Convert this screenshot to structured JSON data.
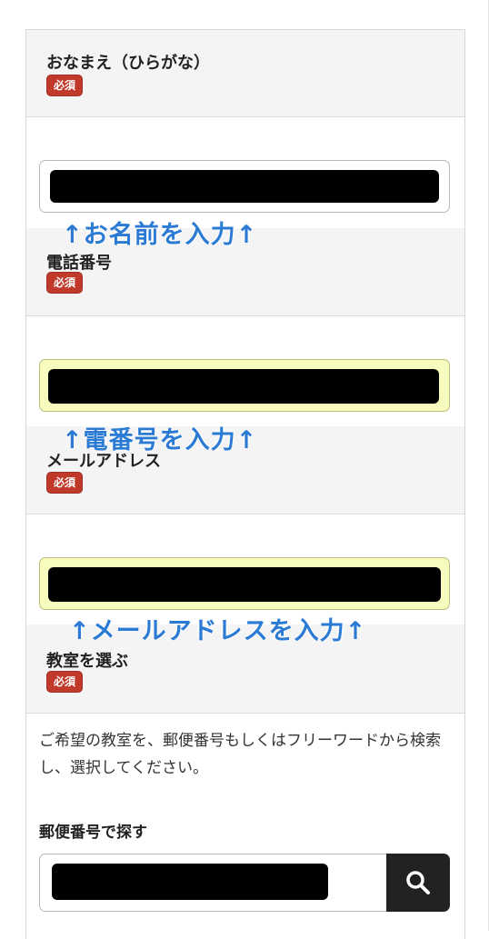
{
  "form": {
    "name_field": {
      "label": "おなまえ（ひらがな）",
      "badge": "必須",
      "annotation": "↑お名前を入力↑"
    },
    "phone_field": {
      "label": "電話番号",
      "badge": "必須",
      "annotation": "↑電番号を入力↑"
    },
    "email_field": {
      "label": "メールアドレス",
      "badge": "必須",
      "annotation": "↑メールアドレスを入力↑"
    },
    "classroom_field": {
      "label": "教室を選ぶ",
      "badge": "必須",
      "description": "ご希望の教室を、郵便番号もしくはフリーワードから検索し、選択してください。",
      "zip_label": "郵便番号で探す",
      "search_icon": "search-icon"
    }
  },
  "colors": {
    "badge": "#c0392b",
    "annotation": "#2b7ad4",
    "highlight_input": "#f7fbbe",
    "search_button": "#222222"
  }
}
